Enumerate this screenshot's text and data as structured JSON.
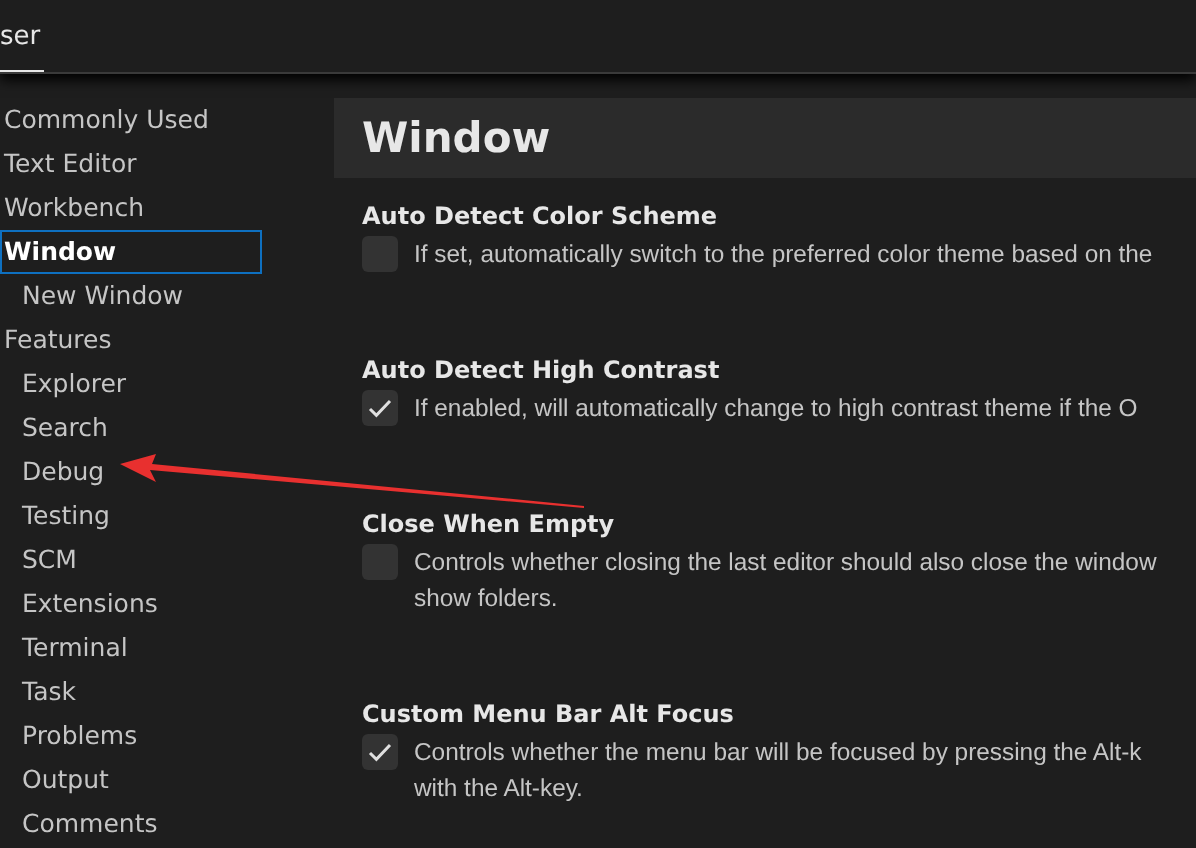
{
  "tabs": [
    {
      "label": "ser",
      "selected": true
    }
  ],
  "sidebar": {
    "items": [
      {
        "label": "Commonly Used",
        "selected": false
      },
      {
        "label": "Text Editor",
        "selected": false
      },
      {
        "label": "Workbench",
        "selected": false
      },
      {
        "label": "Window",
        "selected": true,
        "children": [
          {
            "label": "New Window",
            "selected": false
          }
        ]
      },
      {
        "label": "Features",
        "selected": false,
        "children": [
          {
            "label": "Explorer",
            "selected": false
          },
          {
            "label": "Search",
            "selected": false
          },
          {
            "label": "Debug",
            "selected": false
          },
          {
            "label": "Testing",
            "selected": false
          },
          {
            "label": "SCM",
            "selected": false
          },
          {
            "label": "Extensions",
            "selected": false
          },
          {
            "label": "Terminal",
            "selected": false
          },
          {
            "label": "Task",
            "selected": false
          },
          {
            "label": "Problems",
            "selected": false
          },
          {
            "label": "Output",
            "selected": false
          },
          {
            "label": "Comments",
            "selected": false
          }
        ]
      }
    ]
  },
  "section_title": "Window",
  "settings": [
    {
      "title": "Auto Detect Color Scheme",
      "checked": false,
      "lines": [
        "If set, automatically switch to the preferred color theme based on the"
      ]
    },
    {
      "title": "Auto Detect High Contrast",
      "checked": true,
      "lines": [
        "If enabled, will automatically change to high contrast theme if the O"
      ]
    },
    {
      "title": "Close When Empty",
      "checked": false,
      "lines": [
        "Controls whether closing the last editor should also close the window",
        "show folders."
      ]
    },
    {
      "title": "Custom Menu Bar Alt Focus",
      "checked": true,
      "lines": [
        "Controls whether the menu bar will be focused by pressing the Alt-k",
        "with the Alt-key."
      ]
    }
  ]
}
